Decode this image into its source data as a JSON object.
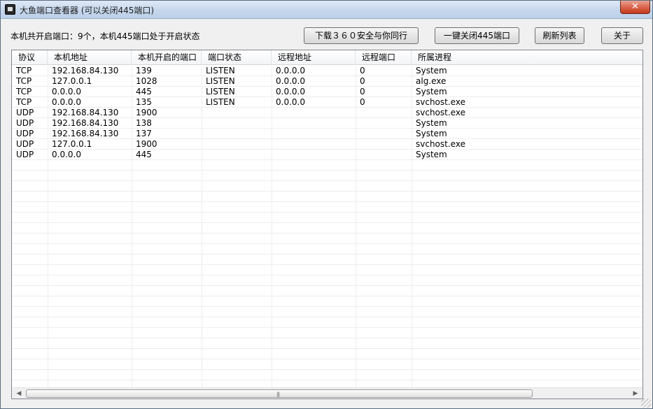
{
  "window": {
    "title": "大鱼端口查看器 (可以关闭445端口)",
    "close_glyph": "✕"
  },
  "toolbar": {
    "status_text": "本机共开启端口：9个，本机445端口处于开启状态",
    "buttons": {
      "download": "下载３６０安全与你同行",
      "close445": "一键关闭445端口",
      "refresh": "刷新列表",
      "about": "关于"
    }
  },
  "table": {
    "columns": [
      "协议",
      "本机地址",
      "本机开启的端口",
      "端口状态",
      "远程地址",
      "远程端口",
      "所属进程"
    ],
    "rows": [
      [
        "TCP",
        "192.168.84.130",
        "139",
        "LISTEN",
        "0.0.0.0",
        "0",
        "System"
      ],
      [
        "TCP",
        "127.0.0.1",
        "1028",
        "LISTEN",
        "0.0.0.0",
        "0",
        "alg.exe"
      ],
      [
        "TCP",
        "0.0.0.0",
        "445",
        "LISTEN",
        "0.0.0.0",
        "0",
        "System"
      ],
      [
        "TCP",
        "0.0.0.0",
        "135",
        "LISTEN",
        "0.0.0.0",
        "0",
        "svchost.exe"
      ],
      [
        "UDP",
        "192.168.84.130",
        "1900",
        "",
        "",
        "",
        "svchost.exe"
      ],
      [
        "UDP",
        "192.168.84.130",
        "138",
        "",
        "",
        "",
        "System"
      ],
      [
        "UDP",
        "192.168.84.130",
        "137",
        "",
        "",
        "",
        "System"
      ],
      [
        "UDP",
        "127.0.0.1",
        "1900",
        "",
        "",
        "",
        "svchost.exe"
      ],
      [
        "UDP",
        "0.0.0.0",
        "445",
        "",
        "",
        "",
        "System"
      ]
    ]
  },
  "scrollbar": {
    "left_glyph": "◀",
    "right_glyph": "▶",
    "grip_glyph": "|||"
  }
}
